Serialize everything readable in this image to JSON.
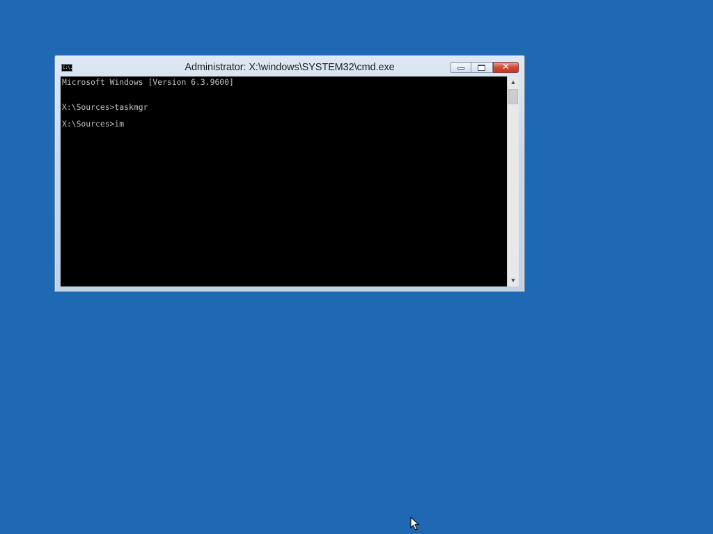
{
  "window": {
    "title": "Administrator: X:\\windows\\SYSTEM32\\cmd.exe",
    "icon": "cmd-icon",
    "icon_text": "C:\\.",
    "close_glyph": "✕"
  },
  "console": {
    "lines": [
      "Microsoft Windows [Version 6.3.9600]",
      "",
      "X:\\Sources>taskmgr",
      "",
      "X:\\Sources>im"
    ]
  },
  "scrollbar": {
    "up": "▲",
    "down": "▼"
  },
  "colors": {
    "desktop": "#1f68b3",
    "console_bg": "#000000",
    "console_text": "#c0c0c0",
    "close_button": "#c0392b"
  }
}
